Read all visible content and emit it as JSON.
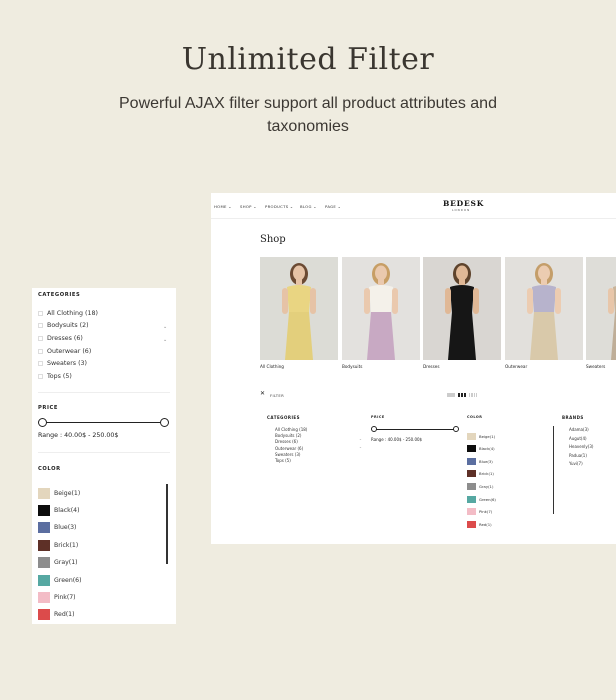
{
  "hero": {
    "title": "Unlimited Filter",
    "subtitle": "Powerful AJAX filter support all product attributes and taxonomies"
  },
  "sidebar": {
    "categories_title": "CATEGORIES",
    "categories": [
      "All Clothing (18)",
      "Bodysuits (2)",
      "Dresses (6)",
      "Outerwear (6)",
      "Sweaters (3)",
      "Tops (5)"
    ],
    "price_title": "PRICE",
    "price_range": "Range : 40.00$ - 250.00$",
    "color_title": "COLOR",
    "colors": [
      {
        "label": "Beige(1)",
        "hex": "#e3d6bd"
      },
      {
        "label": "Black(4)",
        "hex": "#0d0d0d"
      },
      {
        "label": "Blue(3)",
        "hex": "#5b6ea0"
      },
      {
        "label": "Brick(1)",
        "hex": "#5e3027"
      },
      {
        "label": "Gray(1)",
        "hex": "#8d8d8d"
      },
      {
        "label": "Green(6)",
        "hex": "#56a8a2"
      },
      {
        "label": "Pink(7)",
        "hex": "#f3bcc6"
      },
      {
        "label": "Red(1)",
        "hex": "#dc4b4b"
      }
    ]
  },
  "shop": {
    "nav": [
      "HOME",
      "SHOP",
      "PRODUCTS",
      "BLOG",
      "PAGE"
    ],
    "logo": "BEDESK",
    "logo_sub": "LONDON",
    "title": "Shop",
    "cards": [
      {
        "label": "All Clothing",
        "bg": "#dcdcd6",
        "skin": "#e6c3a6",
        "hair": "#6b4a33",
        "top": "#e9d582",
        "bottom": "#e3cf7c"
      },
      {
        "label": "Bodysuits",
        "bg": "#e3e1de",
        "skin": "#eac9ae",
        "hair": "#c79e65",
        "top": "#f4f1ea",
        "bottom": "#c8a9c3"
      },
      {
        "label": "Dresses",
        "bg": "#d9d6d2",
        "skin": "#e0b896",
        "hair": "#5e432c",
        "top": "#161616",
        "bottom": "#161616"
      },
      {
        "label": "Outerwear",
        "bg": "#e2e0dc",
        "skin": "#ecccb1",
        "hair": "#c49e6a",
        "top": "#b7b3cc",
        "bottom": "#d9c9aa"
      },
      {
        "label": "Sweaters",
        "bg": "#deddd8",
        "skin": "#e8c6a9",
        "hair": "#8a6a48",
        "top": "#c9b49a",
        "bottom": "#bfae98"
      }
    ],
    "filter_label": "FILTER",
    "close_glyph": "✕",
    "filters": {
      "categories_title": "CATEGORIES",
      "categories": [
        "All Clothing (18)",
        "Bodysuits (2)",
        "Dresses (6)",
        "Outerwear (6)",
        "Sweaters (3)",
        "Tops (5)"
      ],
      "price_title": "PRICE",
      "price_range": "Range : 40.00$ - 250.00$",
      "color_title": "COLOR",
      "brands_title": "BRANDS",
      "brands": [
        "Adama(3)",
        "Augut(4)",
        "Heavenly(3)",
        "Padua(1)",
        "Yuvi(7)"
      ]
    }
  }
}
